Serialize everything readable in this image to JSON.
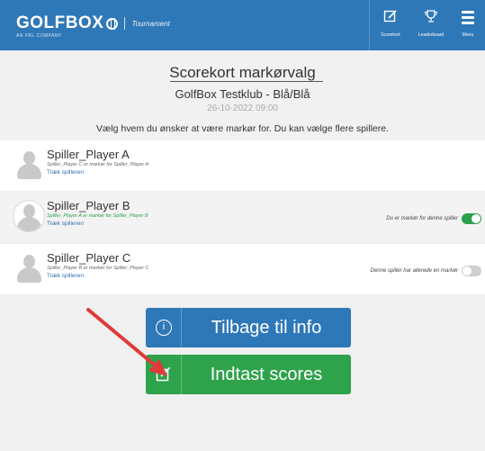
{
  "header": {
    "logo_text": "GOLFBOX",
    "logo_sub": "Tournament",
    "logo_small": "AN FRL COMPANY",
    "nav": {
      "scorecard": "Scorekort",
      "leaderboard": "Leaderboard",
      "menu": "Menu"
    },
    "icons": {
      "scorecard": "scorecard-edit-icon",
      "leaderboard": "trophy-icon",
      "menu": "hamburger-menu-icon"
    },
    "brand_color": "#2f78b8"
  },
  "page": {
    "title": "Scorekort markørvalg",
    "club": "GolfBox Testklub - Blå/Blå",
    "date": "26-10-2022 09:00",
    "instruction": "Vælg hvem du ønsker at være markør for. Du kan vælge flere spillere."
  },
  "players": [
    {
      "name": "Spiller_Player A",
      "meta": "Spiller_Player C er markør for Spiller_Player A",
      "link": "Træk spilleren",
      "status": "",
      "toggle": "none"
    },
    {
      "name": "Spiller_Player B",
      "meta": "Spiller_Player A er markør for Spiller_Player B",
      "link": "Træk spilleren",
      "status": "Du er markør for denne spiller",
      "toggle": "on"
    },
    {
      "name": "Spiller_Player C",
      "meta": "Spiller_Player B er markør for Spiller_Player C",
      "link": "Træk spilleren",
      "status": "Denne spiller har allerede en markør",
      "toggle": "off"
    }
  ],
  "buttons": {
    "info": "Tilbage til info",
    "scores": "Indtast scores",
    "info_icon": "info-circle-icon",
    "scores_icon": "edit-icon",
    "info_color": "#2f78b8",
    "scores_color": "#2fa24c"
  },
  "annotation": {
    "arrow_color": "#e03a3a"
  }
}
